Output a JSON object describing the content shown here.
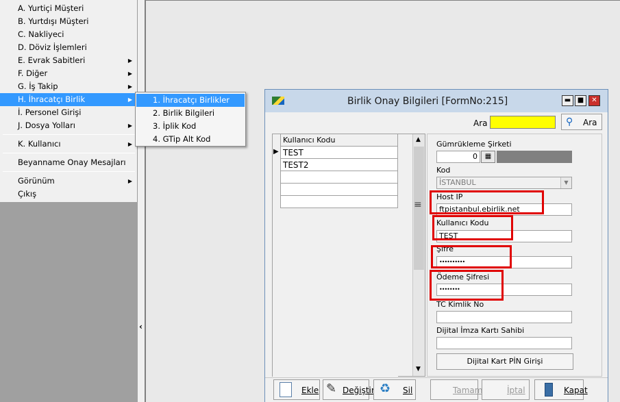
{
  "menu": {
    "items": [
      {
        "label": "A.  Yurtiçi Müşteri",
        "arrow": ""
      },
      {
        "label": "B.  Yurtdışı Müşteri",
        "arrow": ""
      },
      {
        "label": "C.  Nakliyeci",
        "arrow": ""
      },
      {
        "label": "D.  Döviz İşlemleri",
        "arrow": ""
      },
      {
        "label": "E.  Evrak Sabitleri",
        "arrow": "▶"
      },
      {
        "label": "F.  Diğer",
        "arrow": "▶"
      },
      {
        "label": "G.  İş Takip",
        "arrow": "▶"
      },
      {
        "label": "H.  İhracatçı Birlik",
        "arrow": "▶"
      },
      {
        "label": "İ.   Personel Girişi",
        "arrow": ""
      },
      {
        "label": "J.  Dosya Yolları",
        "arrow": "▶"
      }
    ],
    "kullanici": {
      "label": "K.  Kullanıcı",
      "arrow": "▶"
    },
    "beyanname": "Beyanname Onay Mesajları",
    "gorunum": {
      "label": "Görünüm",
      "arrow": "▶"
    },
    "cikis": "Çıkış",
    "collapse_glyph": "‹"
  },
  "submenu": {
    "items": [
      "1.  İhracatçı Birlikler",
      "2.  Birlik Bilgileri",
      "3.  İplik Kod",
      "4.  GTip Alt Kod"
    ]
  },
  "form": {
    "title": "Birlik Onay Bilgileri [FormNo:215]",
    "window_buttons": {
      "minimize": "▬",
      "maximize": "■",
      "close": "✕"
    },
    "search": {
      "label": "Ara",
      "value": "",
      "button": "Ara"
    },
    "grid": {
      "header": "Kullanıcı Kodu",
      "rows": [
        "TEST",
        "TEST2",
        "",
        "",
        ""
      ],
      "current_marker": "▶"
    },
    "splitter_glyph": "≡",
    "fields": {
      "gumrukleme_label": "Gümrükleme Şirketi",
      "gumrukleme_value": "0",
      "kod_label": "Kod",
      "kod_value": "İSTANBUL",
      "host_label": "Host IP",
      "host_value": "ftpistanbul.ebirlik.net",
      "kullanici_label": "Kullanıcı Kodu",
      "kullanici_value": "TEST",
      "sifre_label": "Şifre",
      "sifre_value": "••••••••••",
      "odeme_label": "Ödeme Şifresi",
      "odeme_value": "••••••••",
      "tc_label": "TC Kimlik No",
      "tc_value": "",
      "dijital_label": "Dijital İmza Kartı Sahibi",
      "dijital_value": "",
      "pin_button": "Dijital Kart PİN Girişi"
    },
    "toolbar": {
      "ekle": "Ekle",
      "degistir": "Değiştir",
      "sil": "Sil",
      "tamam": "Tamam",
      "iptal": "İptal",
      "kapat": "Kapat"
    }
  },
  "colors": {
    "accent": "#3399ff",
    "highlight": "#ffff00",
    "red_box": "#e00000"
  }
}
